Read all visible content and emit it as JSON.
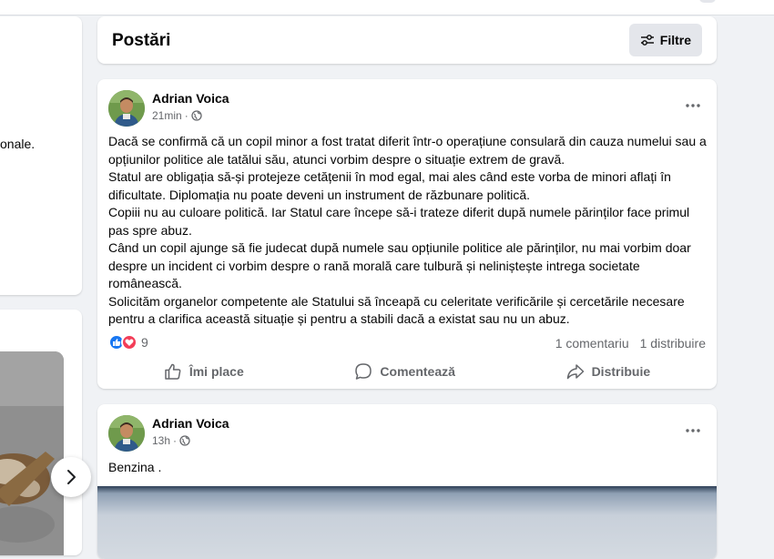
{
  "left_panel": {
    "fragment_text": "onale."
  },
  "feed": {
    "title": "Postări",
    "filter_label": "Filtre"
  },
  "posts": [
    {
      "author": "Adrian Voica",
      "time": "21min",
      "paragraphs": [
        "Dacă se confirmă că un copil minor a fost tratat diferit într-o operațiune consulară din cauza numelui sau a opțiunilor politice ale tatălui său, atunci vorbim despre o situație extrem de gravă.",
        "Statul are obligația să-și protejeze cetățenii în mod egal, mai ales când este vorba de minori aflați în dificultate. Diplomația nu poate deveni un instrument de răzbunare politică.",
        "Copiii nu au culoare politică. Iar Statul care începe să-i trateze diferit după numele părinților face primul pas spre abuz.",
        "Când un copil ajunge să fie judecat după numele sau opțiunile politice ale părinților, nu mai vorbim doar despre un incident ci vorbim despre o rană morală care tulbură și neliniștește intrega societate românească.",
        "Solicităm organelor competente ale Statului să înceapă cu celeritate verificările și cercetările necesare pentru a clarifica această situație și pentru a stabili dacă a existat sau nu un abuz."
      ],
      "reactions_count": "9",
      "comments": "1 comentariu",
      "shares": "1 distribuire",
      "actions": {
        "like": "Îmi place",
        "comment": "Comentează",
        "share": "Distribuie"
      }
    },
    {
      "author": "Adrian Voica",
      "time": "13h",
      "text": "Benzina ."
    }
  ],
  "colors": {
    "like_blue": "#1877f2",
    "love_red": "#f33e58",
    "muted_text": "#65676b",
    "page_bg": "#f0f2f5"
  }
}
